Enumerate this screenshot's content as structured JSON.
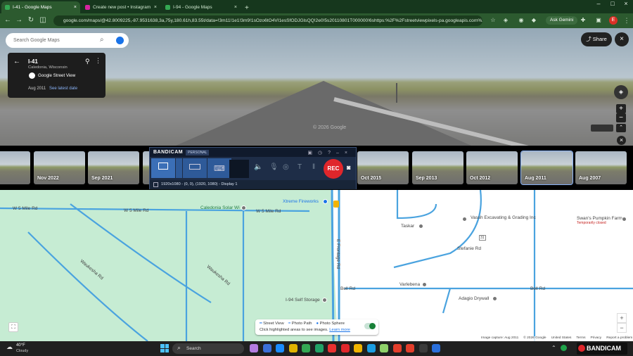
{
  "browser": {
    "tabs": [
      {
        "title": "I-41 - Google Maps",
        "active": true,
        "favicon_color": "#34a853"
      },
      {
        "title": "Create new post • Instagram",
        "active": false,
        "favicon_color": "#d6249f"
      },
      {
        "title": "I-94 - Google Maps",
        "active": false,
        "favicon_color": "#34a853"
      }
    ],
    "url": "google.com/maps/@42.8009225,-87.9531638,3a,75y,180.61h,83.55t/data=!3m11!1e1!3m9!1sOzo6tO4VI1esSfODJGlsQQ!2e0!5s20110801T000000!6shttps:%2F%2Fstreetviewpixels-pa.googleapis.com%2Fv1...",
    "ask_gemini": "Ask Gemini",
    "profile_initial": "E"
  },
  "streetview": {
    "search_placeholder": "Search Google Maps",
    "place_title": "I-41",
    "place_subtitle": "Caledonia, Wisconsin",
    "source": "Google Street View",
    "capture_date": "Aug 2011",
    "see_latest": "See latest date",
    "share_label": "Share",
    "watermark": "© 2026 Google"
  },
  "timeline": {
    "thumbs": [
      {
        "label": "3"
      },
      {
        "label": "Nov 2022"
      },
      {
        "label": "Sep 2021"
      },
      {
        "label": ""
      },
      {
        "label": "Oct 2015"
      },
      {
        "label": "Sep 2013"
      },
      {
        "label": "Oct 2012"
      },
      {
        "label": "Aug 2011"
      },
      {
        "label": "Aug 2007"
      }
    ]
  },
  "bandicam": {
    "logo": "BANDICAM",
    "edition": "PERSONAL",
    "rec_label": "REC",
    "capture_info": "1920x1080 - (0, 0), (1920, 1080) - Display 1"
  },
  "map": {
    "labels": {
      "w5mile_left": "W 5 Mile Rd",
      "w5mile_mid": "W 5 Mile Rd",
      "w5mile_right": "W 5 Mile Rd",
      "caledonia_solar": "Caledonia Solar Wi",
      "xtreme": "Xtreme Fireworks",
      "frontage": "E Frontage Rd",
      "taskar": "Taskar",
      "vassh": "Vassh Excavating & Grading Inc",
      "swans": "Swan's Pumpkin Farm",
      "swans_sub": "Temporarily closed",
      "stefanie": "Stefanie Rd",
      "bell": "Bell Rd",
      "varlebena": "Varlebena",
      "adagio": "Adagio Drywall",
      "i94storage": "I-94 Self Storage",
      "wauk_left": "Waukesha Rd",
      "wauk_right": "Waukesha Rd",
      "route31": "31"
    },
    "legend": {
      "street_view": "Street View",
      "photo_path": "Photo Path",
      "photo_sphere": "Photo Sphere",
      "hint": "Click highlighted areas to see images.",
      "learn_more": "Learn more"
    },
    "attribution": [
      "Image capture: Aug 2011",
      "© 2026 Google",
      "United States",
      "Terms",
      "Privacy",
      "Report a problem"
    ],
    "colors": {
      "road": "#4aa3df",
      "park": "#c6ecd3",
      "land": "#ffffff"
    }
  },
  "taskbar": {
    "weather_temp": "40°F",
    "weather_desc": "Cloudy",
    "search_placeholder": "Search",
    "tray_label": "BANDICAM"
  }
}
